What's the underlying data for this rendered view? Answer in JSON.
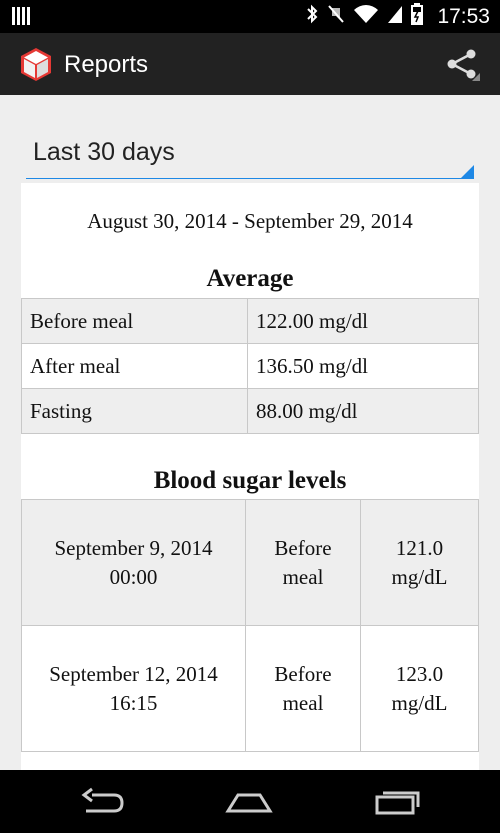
{
  "status_bar": {
    "time": "17:53",
    "icons": [
      "signal-bars-icon",
      "bluetooth-icon",
      "mute-icon",
      "wifi-icon",
      "cell-signal-icon",
      "battery-icon"
    ]
  },
  "action_bar": {
    "title": "Reports",
    "app_icon": "cube-icon",
    "share_icon": "share-icon",
    "background": "#222222"
  },
  "spinner": {
    "selected": "Last 30 days",
    "accent": "#1e88e5"
  },
  "report": {
    "date_range": "August 30, 2014 - September 29, 2014",
    "average_title": "Average",
    "averages": [
      {
        "label": "Before meal",
        "value": "122.00 mg/dl"
      },
      {
        "label": "After meal",
        "value": "136.50 mg/dl"
      },
      {
        "label": "Fasting",
        "value": "88.00 mg/dl"
      }
    ],
    "levels_title": "Blood sugar levels",
    "levels": [
      {
        "date": "September 9, 2014",
        "time": "00:00",
        "meal_1": "Before",
        "meal_2": "meal",
        "value": "121.0",
        "unit": "mg/dL"
      },
      {
        "date": "September 12, 2014",
        "time": "16:15",
        "meal_1": "Before",
        "meal_2": "meal",
        "value": "123.0",
        "unit": "mg/dL"
      }
    ]
  },
  "nav_bar": {
    "icons": [
      "back-icon",
      "home-icon",
      "recents-icon"
    ]
  }
}
